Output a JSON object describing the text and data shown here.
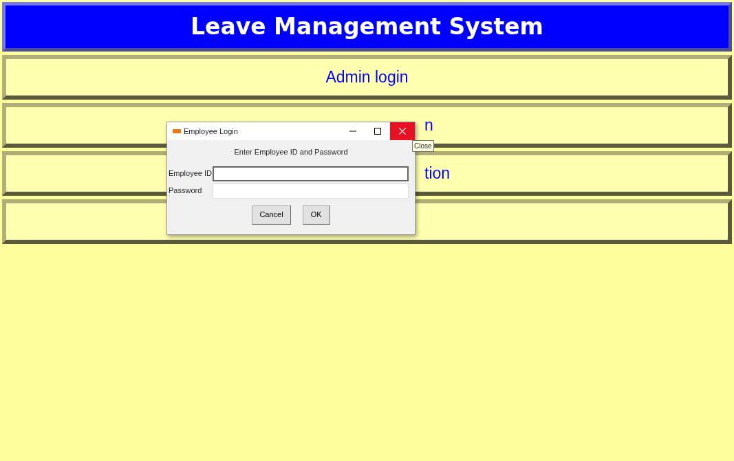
{
  "header": {
    "title": "Leave Management System"
  },
  "menu_buttons": [
    {
      "kind": "centered",
      "label": "Admin login"
    },
    {
      "kind": "partial",
      "label": "n"
    },
    {
      "kind": "partial",
      "label": "tion"
    },
    {
      "kind": "blank"
    }
  ],
  "dialog": {
    "title": "Employee Login",
    "prompt": "Enter Employee ID and Password",
    "fields": [
      {
        "label": "Employee ID",
        "focused": true
      },
      {
        "label": "Password",
        "focused": false
      }
    ],
    "buttons": [
      "Cancel",
      "OK"
    ],
    "tooltip": "Close"
  }
}
